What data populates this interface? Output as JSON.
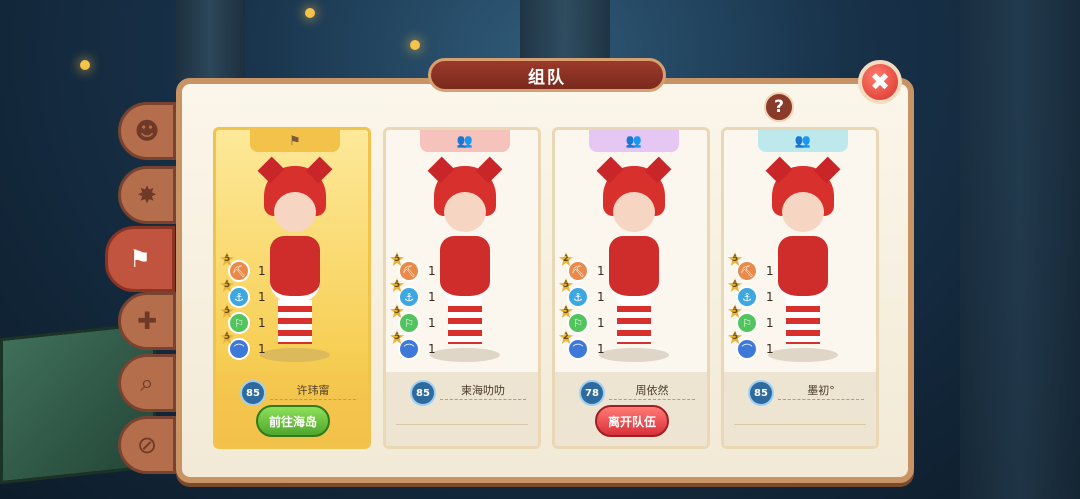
{
  "window": {
    "title": "组队"
  },
  "sidebar": [
    {
      "icon": "skull-face-icon"
    },
    {
      "icon": "shield-crest-icon"
    },
    {
      "icon": "flag-icon",
      "active": true
    },
    {
      "icon": "add-friend-icon"
    },
    {
      "icon": "search-icon"
    },
    {
      "icon": "block-user-icon"
    }
  ],
  "help": {
    "label": "?"
  },
  "close": {
    "label": "✖"
  },
  "members": [
    {
      "role": "leader",
      "head_icon": "flag-icon",
      "head_glyph": "⚑",
      "level": "85",
      "name": "许玮甯",
      "skills": [
        {
          "level": "5",
          "icon": "pickaxe-icon",
          "glyph": "⛏",
          "color": "#e98a4a",
          "count": "1"
        },
        {
          "level": "5",
          "icon": "fishing-icon",
          "glyph": "⚓",
          "color": "#3ea7e2",
          "count": "1"
        },
        {
          "level": "5",
          "icon": "flag-green-icon",
          "glyph": "⚐",
          "color": "#52c45e",
          "count": "1"
        },
        {
          "level": "5",
          "icon": "net-icon",
          "glyph": "⌒",
          "color": "#3e78d8",
          "count": "1"
        }
      ],
      "button": {
        "label": "前往海岛",
        "style": "green"
      }
    },
    {
      "role": "member",
      "head_icon": "team-icon",
      "head_glyph": "👥",
      "level": "85",
      "name": "柬海叻叻",
      "skills": [
        {
          "level": "5",
          "icon": "pickaxe-icon",
          "glyph": "⛏",
          "color": "#e98a4a",
          "count": "1"
        },
        {
          "level": "5",
          "icon": "fishing-icon",
          "glyph": "⚓",
          "color": "#3ea7e2",
          "count": "1"
        },
        {
          "level": "5",
          "icon": "flag-green-icon",
          "glyph": "⚐",
          "color": "#52c45e",
          "count": "1"
        },
        {
          "level": "5",
          "icon": "net-icon",
          "glyph": "⌒",
          "color": "#3e78d8",
          "count": "1"
        }
      ],
      "button": null
    },
    {
      "role": "member",
      "head_icon": "team-icon",
      "head_glyph": "👥",
      "level": "78",
      "name": "周依然",
      "skills": [
        {
          "level": "2",
          "icon": "pickaxe-icon",
          "glyph": "⛏",
          "color": "#e98a4a",
          "count": "1"
        },
        {
          "level": "5",
          "icon": "fishing-icon",
          "glyph": "⚓",
          "color": "#3ea7e2",
          "count": "1"
        },
        {
          "level": "5",
          "icon": "flag-green-icon",
          "glyph": "⚐",
          "color": "#52c45e",
          "count": "1"
        },
        {
          "level": "2",
          "icon": "net-icon",
          "glyph": "⌒",
          "color": "#3e78d8",
          "count": "1"
        }
      ],
      "button": {
        "label": "离开队伍",
        "style": "red"
      }
    },
    {
      "role": "member",
      "head_icon": "team-icon",
      "head_glyph": "👥",
      "level": "85",
      "name": "墨初°",
      "skills": [
        {
          "level": "5",
          "icon": "pickaxe-icon",
          "glyph": "⛏",
          "color": "#e98a4a",
          "count": "1"
        },
        {
          "level": "5",
          "icon": "fishing-icon",
          "glyph": "⚓",
          "color": "#3ea7e2",
          "count": "1"
        },
        {
          "level": "5",
          "icon": "flag-green-icon",
          "glyph": "⚐",
          "color": "#52c45e",
          "count": "1"
        },
        {
          "level": "5",
          "icon": "net-icon",
          "glyph": "⌒",
          "color": "#3e78d8",
          "count": "1"
        }
      ],
      "button": null
    }
  ]
}
